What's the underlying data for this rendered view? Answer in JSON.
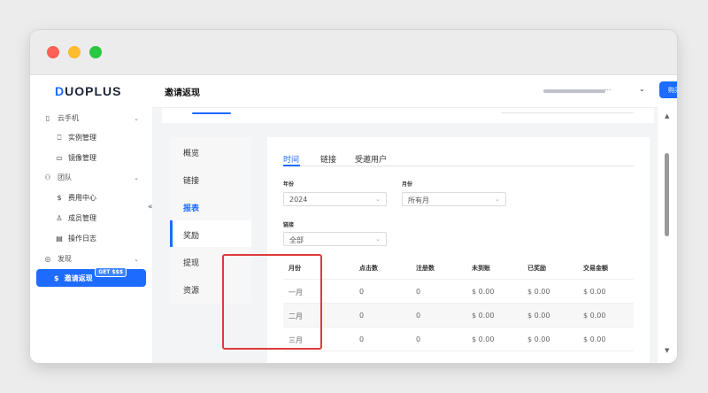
{
  "app": {
    "logo_initial": "D",
    "logo_rest": "UOPLUS"
  },
  "sidebar": {
    "groups": [
      {
        "label": "云手机",
        "icon": "phone-icon"
      },
      {
        "label": "团队",
        "icon": "team-icon"
      },
      {
        "label": "发现",
        "icon": "compass-icon"
      }
    ],
    "items": [
      {
        "label": "实例管理",
        "icon": "instance-icon"
      },
      {
        "label": "镜像管理",
        "icon": "monitor-icon"
      },
      {
        "label": "费用中心",
        "icon": "dollar-icon"
      },
      {
        "label": "成员管理",
        "icon": "members-icon"
      },
      {
        "label": "操作日志",
        "icon": "log-icon"
      }
    ],
    "active": {
      "label": "邀请返现",
      "icon": "dollar-icon",
      "badge": "GET $$$"
    },
    "collapse_glyph": "«"
  },
  "header": {
    "title": "邀请返现",
    "account_suffix": "...",
    "buy_label": "购买 +"
  },
  "side_tabs": [
    "概览",
    "链接",
    "报表",
    "奖励",
    "提现",
    "资源"
  ],
  "side_tab_active": "报表",
  "report_tabs": [
    "时间",
    "链接",
    "受邀用户"
  ],
  "report_tab_active": "时间",
  "filters": {
    "year_label": "年份",
    "year_value": "2024",
    "month_label": "月份",
    "month_value": "所有月",
    "link_label": "链接",
    "link_value": "全部"
  },
  "table": {
    "headers": [
      "月份",
      "点击数",
      "注册数",
      "未到账",
      "已奖励",
      "交易金额"
    ],
    "rows": [
      [
        "一月",
        "0",
        "0",
        "$ 0.00",
        "$ 0.00",
        "$ 0.00"
      ],
      [
        "二月",
        "0",
        "0",
        "$ 0.00",
        "$ 0.00",
        "$ 0.00"
      ],
      [
        "三月",
        "0",
        "0",
        "$ 0.00",
        "$ 0.00",
        "$ 0.00"
      ]
    ]
  },
  "colors": {
    "accent": "#1e6bff",
    "highlight": "#e03a3a"
  }
}
